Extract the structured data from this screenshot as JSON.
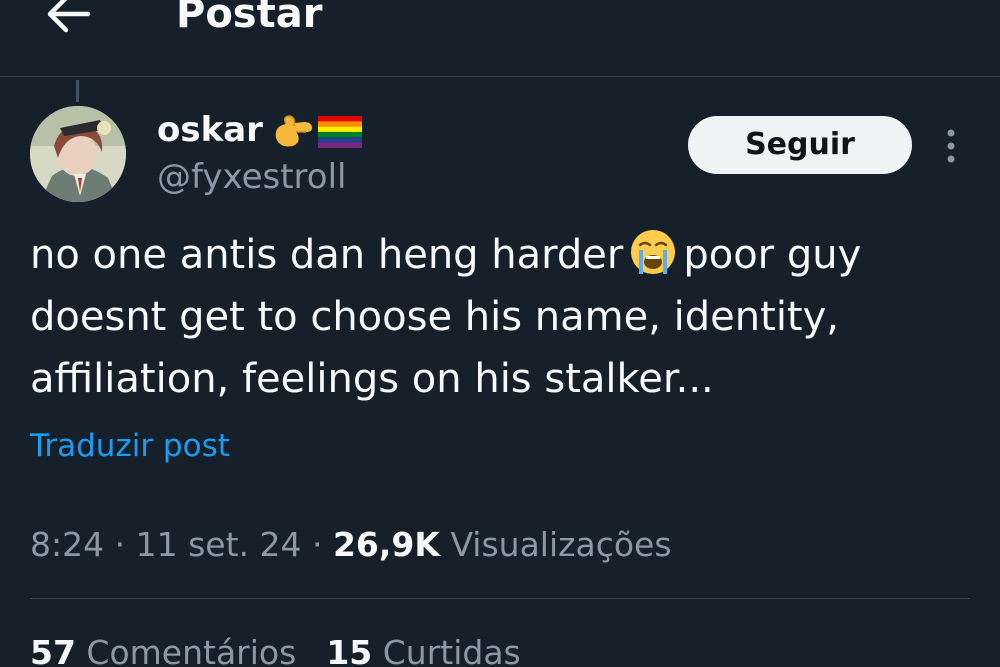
{
  "header": {
    "title": "Postar",
    "back_icon": "arrow-left-icon"
  },
  "author": {
    "display_name": "oskar",
    "name_emojis": [
      "pinching-hand-emoji",
      "rainbow-flag-emoji"
    ],
    "handle": "@fyxestroll"
  },
  "follow_button": {
    "label": "Seguir"
  },
  "more_icon": "vertical-ellipsis-icon",
  "post": {
    "line1_a": "no one antis dan heng harder",
    "line1_emoji": "loudly-crying-face-emoji",
    "line1_b": "poor guy",
    "line2": "doesnt get to choose his name, identity,",
    "line3": "affiliation, feelings on his stalker..."
  },
  "translate_link": "Traduzir post",
  "meta": {
    "time": "8:24",
    "sep1": " · ",
    "date": "11 set. 24",
    "sep2": " · ",
    "views_count": "26,9K",
    "views_label": " Visualizações"
  },
  "stats": {
    "comments_count": "57",
    "comments_label": " Comentários",
    "likes_count": "15",
    "likes_label": " Curtidas"
  },
  "colors": {
    "background": "#15202b",
    "text": "#f7f9f9",
    "secondary_text": "#8b98a5",
    "link": "#1d9bf0",
    "follow_button_bg": "#eff3f4",
    "divider": "#38444d"
  }
}
